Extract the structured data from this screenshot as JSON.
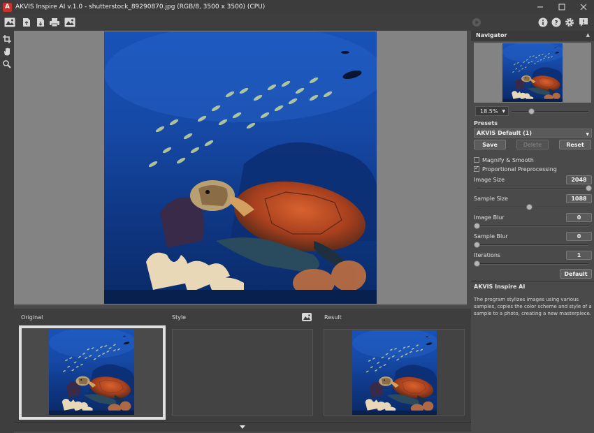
{
  "window": {
    "logo_letter": "A",
    "title": "AKVIS Inspire AI v.1.0 - shutterstock_89290870.jpg (RGB/8, 3500 x 3500) (CPU)"
  },
  "toolbar": {
    "left_icons": [
      "before-after-icon",
      "open-file-icon",
      "save-file-icon",
      "print-icon",
      "share-image-icon"
    ],
    "run_icon": "run-icon",
    "right_icons": [
      "info-icon",
      "help-icon",
      "settings-icon",
      "notification-icon"
    ]
  },
  "tools": [
    "crop-icon",
    "hand-icon",
    "zoom-icon"
  ],
  "navigator": {
    "title": "Navigator",
    "zoom": "18.5%",
    "zoom_level_fraction": 0.25
  },
  "presets": {
    "label": "Presets",
    "selected": "AKVIS Default (1)",
    "save": "Save",
    "delete": "Delete",
    "reset": "Reset"
  },
  "options": {
    "magnify_smooth": {
      "label": "Magnify & Smooth",
      "checked": false
    },
    "proportional": {
      "label": "Proportional Preprocessing",
      "checked": true
    }
  },
  "params": [
    {
      "label": "Image Size",
      "value": "2048",
      "fraction": 1.0
    },
    {
      "label": "Sample Size",
      "value": "1088",
      "fraction": 0.47
    },
    {
      "label": "Image Blur",
      "value": "0",
      "fraction": 0.0
    },
    {
      "label": "Sample Blur",
      "value": "0",
      "fraction": 0.0
    },
    {
      "label": "Iterations",
      "value": "1",
      "fraction": 0.0
    }
  ],
  "default_button": "Default",
  "info": {
    "title": "AKVIS Inspire AI",
    "text": "The program stylizes images using various samples, copies the color scheme and style of a sample to a photo, creating a new masterpiece."
  },
  "bottom": {
    "original": "Original",
    "style": "Style",
    "result": "Result"
  },
  "colors": {
    "accent_red": "#c8302c",
    "ocean_deep": "#0b2a6e",
    "ocean_light": "#1f6fd0"
  }
}
